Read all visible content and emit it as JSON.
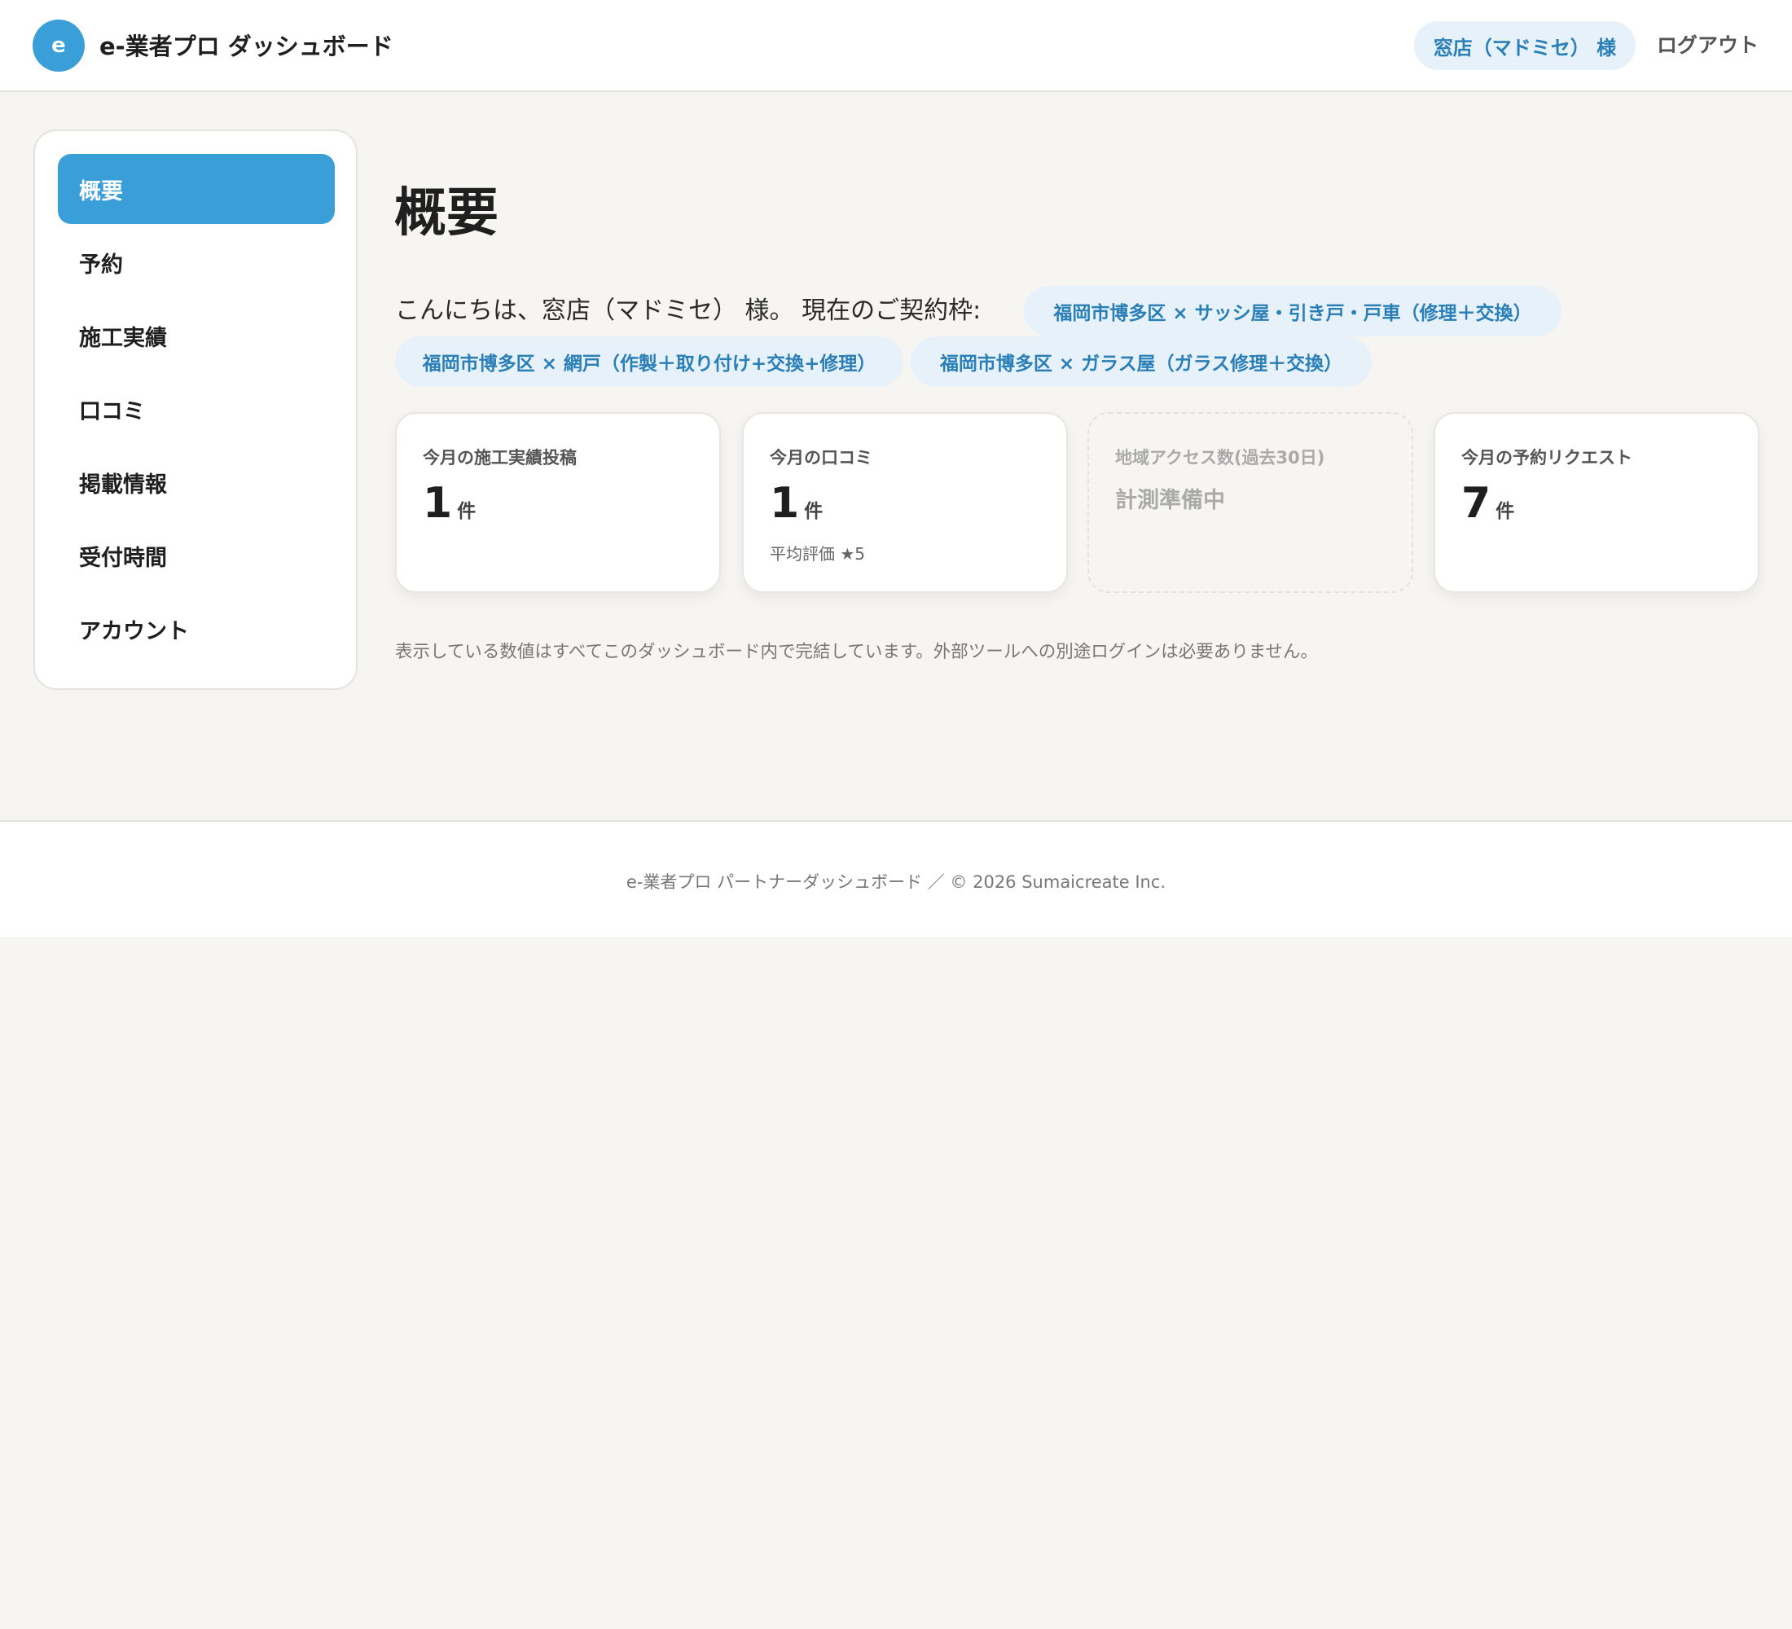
{
  "header": {
    "logo_letter": "e",
    "app_title": "e-業者プロ ダッシュボード",
    "user_label": "窓店（マドミセ） 様",
    "logout_label": "ログアウト"
  },
  "sidebar": {
    "items": [
      {
        "label": "概要",
        "active": true
      },
      {
        "label": "予約",
        "active": false
      },
      {
        "label": "施工実績",
        "active": false
      },
      {
        "label": "口コミ",
        "active": false
      },
      {
        "label": "掲載情報",
        "active": false
      },
      {
        "label": "受付時間",
        "active": false
      },
      {
        "label": "アカウント",
        "active": false
      }
    ]
  },
  "main": {
    "title": "概要",
    "greeting": "こんにちは、窓店（マドミセ） 様。 現在のご契約枠:",
    "contract_tags": [
      "福岡市博多区 × サッシ屋・引き戸・戸車（修理＋交換）",
      "福岡市博多区 × 網戸（作製＋取り付け+交換+修理）",
      "福岡市博多区 × ガラス屋（ガラス修理＋交換）"
    ],
    "stats": [
      {
        "label": "今月の施工実績投稿",
        "value": "1",
        "unit": "件"
      },
      {
        "label": "今月の口コミ",
        "value": "1",
        "unit": "件",
        "sub": "平均評価 ★5"
      },
      {
        "label": "地域アクセス数(過去30日)",
        "status": "計測準備中"
      },
      {
        "label": "今月の予約リクエスト",
        "value": "7",
        "unit": "件"
      }
    ],
    "note": "表示している数値はすべてこのダッシュボード内で完結しています。外部ツールへの別途ログインは必要ありません。"
  },
  "footer": {
    "text": "e-業者プロ パートナーダッシュボード ／ © 2026 Sumaicreate Inc."
  },
  "colors": {
    "accent": "#3a9fd9",
    "tag_bg": "#e6f1f9",
    "tag_text": "#2a7fb7",
    "page_bg": "#f6f5f2"
  }
}
